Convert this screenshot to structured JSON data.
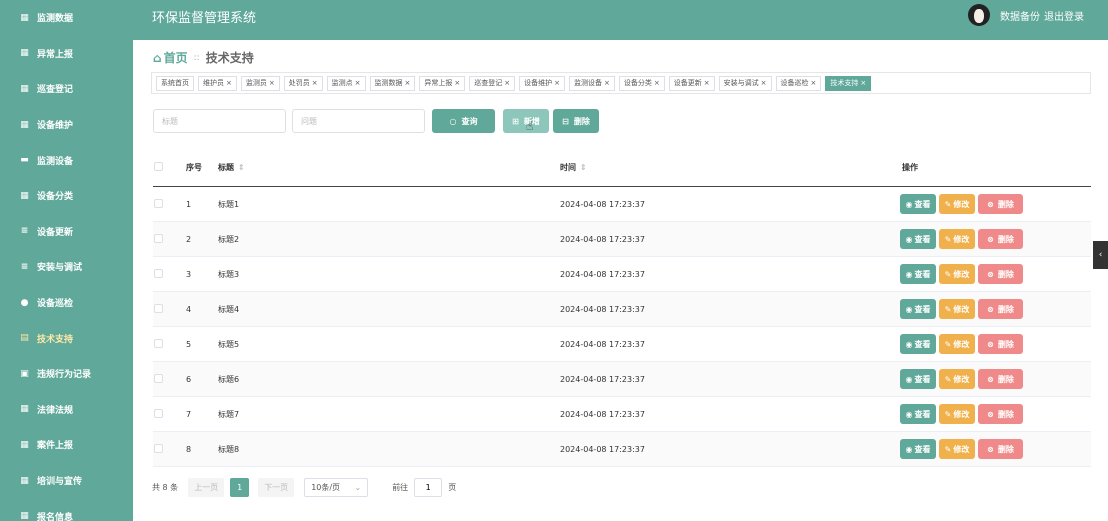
{
  "header": {
    "app_title": "环保监督管理系统",
    "backup_label": "数据备份",
    "logout_label": "退出登录"
  },
  "sidebar": {
    "items": [
      {
        "label": "监测数据",
        "icon": "grid-icon",
        "glyph": "▦"
      },
      {
        "label": "异常上报",
        "icon": "grid-icon",
        "glyph": "▦"
      },
      {
        "label": "巡查登记",
        "icon": "grid-icon",
        "glyph": "▦"
      },
      {
        "label": "设备维护",
        "icon": "grid-icon",
        "glyph": "▦"
      },
      {
        "label": "监测设备",
        "icon": "briefcase-icon",
        "glyph": "▬"
      },
      {
        "label": "设备分类",
        "icon": "grid-icon",
        "glyph": "▦"
      },
      {
        "label": "设备更新",
        "icon": "list-icon",
        "glyph": "≡"
      },
      {
        "label": "安装与调试",
        "icon": "list-icon",
        "glyph": "≡"
      },
      {
        "label": "设备巡检",
        "icon": "location-icon",
        "glyph": "●"
      },
      {
        "label": "技术支持",
        "icon": "document-icon",
        "glyph": "▤"
      },
      {
        "label": "违规行为记录",
        "icon": "clipboard-icon",
        "glyph": "▣"
      },
      {
        "label": "法律法规",
        "icon": "grid-icon",
        "glyph": "▦"
      },
      {
        "label": "案件上报",
        "icon": "grid-icon",
        "glyph": "▦"
      },
      {
        "label": "培训与宣传",
        "icon": "table-icon",
        "glyph": "▦"
      },
      {
        "label": "报名信息",
        "icon": "grid-icon",
        "glyph": "▦"
      }
    ],
    "active_index": 9
  },
  "breadcrumb": {
    "home": "首页",
    "separator": "::",
    "current": "技术支持"
  },
  "tags": [
    {
      "label": "系统首页",
      "closable": false
    },
    {
      "label": "维护员",
      "closable": true
    },
    {
      "label": "监测员",
      "closable": true
    },
    {
      "label": "处罚员",
      "closable": true
    },
    {
      "label": "监测点",
      "closable": true
    },
    {
      "label": "监测数据",
      "closable": true
    },
    {
      "label": "异常上报",
      "closable": true
    },
    {
      "label": "巡查登记",
      "closable": true
    },
    {
      "label": "设备维护",
      "closable": true
    },
    {
      "label": "监测设备",
      "closable": true
    },
    {
      "label": "设备分类",
      "closable": true
    },
    {
      "label": "设备更新",
      "closable": true
    },
    {
      "label": "安装与调试",
      "closable": true
    },
    {
      "label": "设备巡检",
      "closable": true
    },
    {
      "label": "技术支持",
      "closable": true,
      "active": true
    }
  ],
  "search": {
    "title_placeholder": "标题",
    "question_placeholder": "问题",
    "query_label": "查询",
    "add_label": "新增",
    "delete_label": "删除"
  },
  "table": {
    "headers": {
      "no": "序号",
      "title": "标题",
      "time": "时间",
      "ops": "操作"
    },
    "rows": [
      {
        "no": "1",
        "title": "标题1",
        "time": "2024-04-08 17:23:37"
      },
      {
        "no": "2",
        "title": "标题2",
        "time": "2024-04-08 17:23:37"
      },
      {
        "no": "3",
        "title": "标题3",
        "time": "2024-04-08 17:23:37"
      },
      {
        "no": "4",
        "title": "标题4",
        "time": "2024-04-08 17:23:37"
      },
      {
        "no": "5",
        "title": "标题5",
        "time": "2024-04-08 17:23:37"
      },
      {
        "no": "6",
        "title": "标题6",
        "time": "2024-04-08 17:23:37"
      },
      {
        "no": "7",
        "title": "标题7",
        "time": "2024-04-08 17:23:37"
      },
      {
        "no": "8",
        "title": "标题8",
        "time": "2024-04-08 17:23:37"
      }
    ],
    "ops": {
      "view": "查看",
      "edit": "修改",
      "delete": "删除"
    }
  },
  "pagination": {
    "total_text": "共 8 条",
    "prev_label": "上一页",
    "current_page": "1",
    "next_label": "下一页",
    "page_size": "10条/页",
    "goto_label": "前往",
    "goto_value": "1",
    "page_suffix": "页"
  },
  "colors": {
    "primary": "#5fa89a",
    "edit": "#f0b14c",
    "danger": "#f08a8a",
    "active_menu_text": "#ffe9a8"
  }
}
